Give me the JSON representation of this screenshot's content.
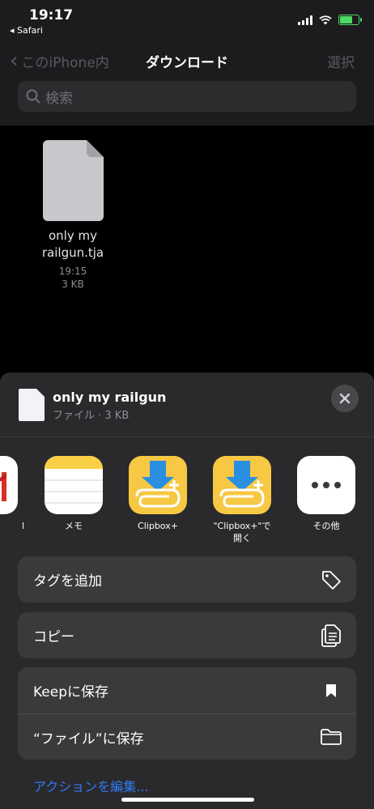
{
  "status": {
    "time": "19:17",
    "back_app": "◂ Safari"
  },
  "nav": {
    "back_label": "このiPhone内",
    "title": "ダウンロード",
    "select_label": "選択"
  },
  "search": {
    "placeholder": "検索"
  },
  "file": {
    "name_line1": "only my",
    "name_line2": "railgun.tja",
    "time": "19:15",
    "size": "3 KB"
  },
  "sheet": {
    "title": "only my railgun",
    "subtitle": "ファイル · 3 KB",
    "apps": [
      {
        "label": "l",
        "icon": "gmail-icon"
      },
      {
        "label": "メモ",
        "icon": "notes-icon"
      },
      {
        "label": "Clipbox+",
        "icon": "clipbox-icon"
      },
      {
        "label": "\"Clipbox+\"で",
        "label2": "開く",
        "icon": "clipbox-open-icon"
      },
      {
        "label": "その他",
        "icon": "more-icon"
      }
    ],
    "actions": [
      {
        "label": "タグを追加",
        "icon": "tag-icon"
      },
      {
        "label": "コピー",
        "icon": "copy-icon"
      },
      {
        "label": "Keepに保存",
        "icon": "bookmark-icon"
      },
      {
        "label": "“ファイル”に保存",
        "icon": "folder-icon"
      }
    ],
    "edit_actions": "アクションを編集..."
  },
  "colors": {
    "accent": "#2f7bf5",
    "battery": "#4cd964",
    "clipbox_yellow": "#f7c843",
    "clipbox_blue": "#2a8fe0"
  }
}
